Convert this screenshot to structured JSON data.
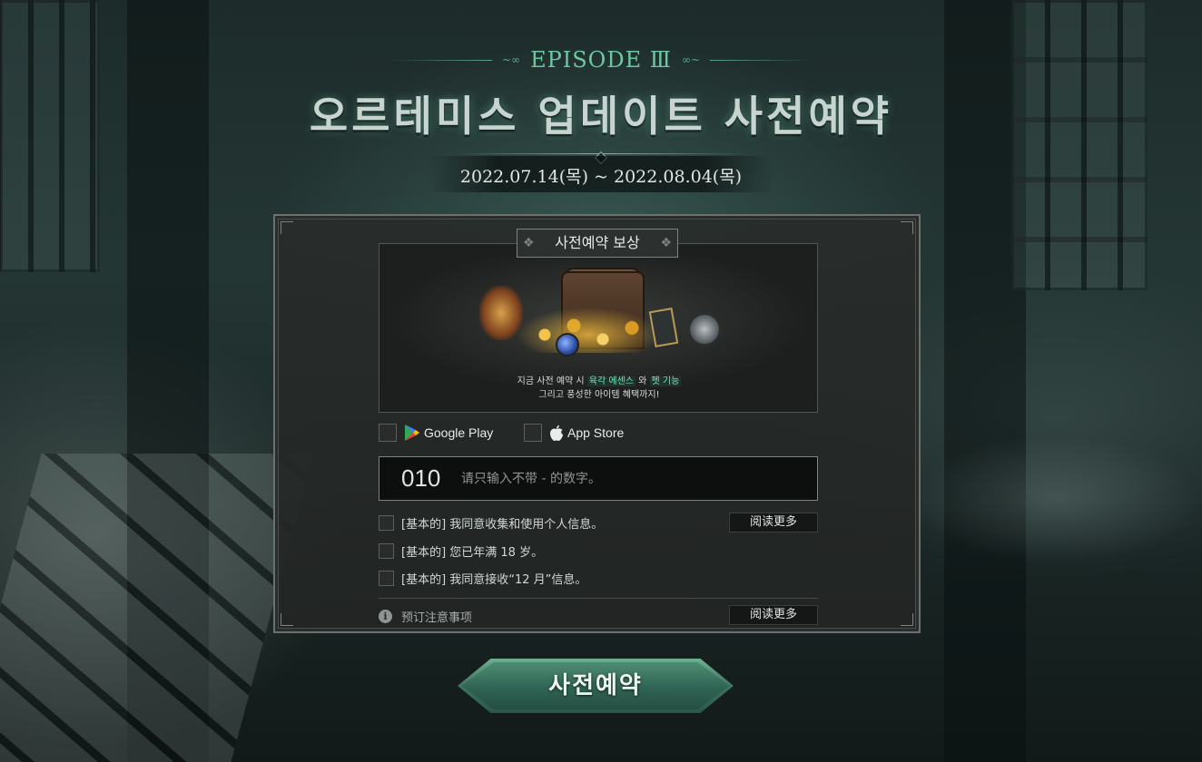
{
  "header": {
    "episode": "EPISODE Ⅲ",
    "episode_deco_left": "~∞",
    "episode_deco_right": "∞~",
    "title": "오르테미스 업데이트 사전예약",
    "date_range": "2022.07.14(목) ~ 2022.08.04(목)"
  },
  "reward": {
    "label": "사전예약 보상",
    "line1_prefix": "지금 사전 예약 시 ",
    "line1_highlight1": "육각 에센스",
    "line1_mid": " 와 ",
    "line1_highlight2": "펫 기능",
    "line2": "그리고 풍성한 아이템 혜택까지!"
  },
  "stores": {
    "google_label": "Google Play",
    "apple_label": "App Store"
  },
  "phone": {
    "prefix": "010",
    "placeholder": "请只输入不带 - 的数字。"
  },
  "agreements": [
    {
      "text": "[基本的] 我同意收集和使用个人信息。",
      "has_readmore": true
    },
    {
      "text": "[基本的] 您已年满 18 岁。",
      "has_readmore": false
    },
    {
      "text": "[基本的] 我同意接收“12 月”信息。",
      "has_readmore": false
    }
  ],
  "readmore_label": "阅读更多",
  "notice": {
    "icon": "info-icon",
    "text": "预订注意事项"
  },
  "submit_label": "사전예약",
  "colors": {
    "accent": "#6cc8a3",
    "highlight": "#73e6b8",
    "button": "#3d7562"
  }
}
